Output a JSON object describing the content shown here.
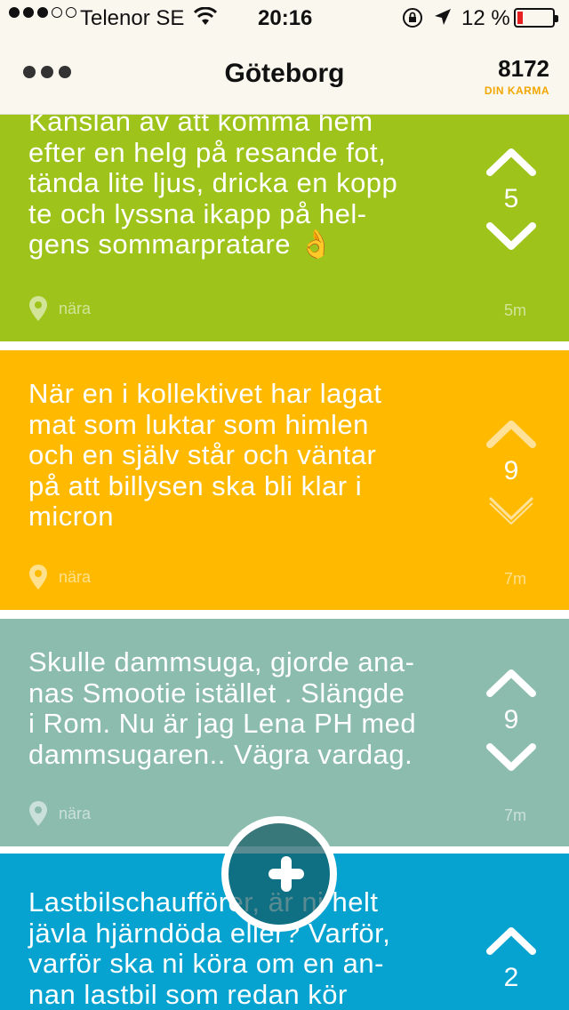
{
  "status_bar": {
    "carrier": "Telenor SE",
    "time": "20:16",
    "battery": "12 %",
    "battery_level": 0.12
  },
  "header": {
    "title": "Göteborg",
    "karma_value": "8172",
    "karma_label": "DIN KARMA"
  },
  "posts": [
    {
      "text": "Känslan av att komma hem\nefter en helg på resande fot,\ntända lite ljus, dricka en kopp\nte och lyssna ikapp på hel-\ngens sommarpratare 👌",
      "votes": "5",
      "location": "nära",
      "time_ago": "5m",
      "color": "#9ec41c"
    },
    {
      "text": "När en i kollektivet har lagat\nmat som luktar som himlen\noch en själv står och väntar\npå att billysen ska bli klar i\nmicron",
      "votes": "9",
      "location": "nära",
      "time_ago": "7m",
      "color": "#ffba00"
    },
    {
      "text": "Skulle dammsuga, gjorde ana-\nnas Smootie istället . Slängde\ni Rom. Nu är jag Lena PH med\ndammsugaren.. Vägra vardag.",
      "votes": "9",
      "location": "nära",
      "time_ago": "7m",
      "color": "#8cbcae"
    },
    {
      "text": "Lastbilschaufförer, är ni helt\njävla hjärndöda eller? Varför,\nvarför ska ni köra om en an-\nnan lastbil som redan kör",
      "votes": "2",
      "location": "",
      "time_ago": "",
      "color": "#06a3d0"
    }
  ],
  "icons": {
    "menu": "three-dots-icon",
    "upvote": "chevron-up-icon",
    "downvote": "chevron-down-icon",
    "location": "location-pin-icon",
    "compose": "plus-icon"
  }
}
